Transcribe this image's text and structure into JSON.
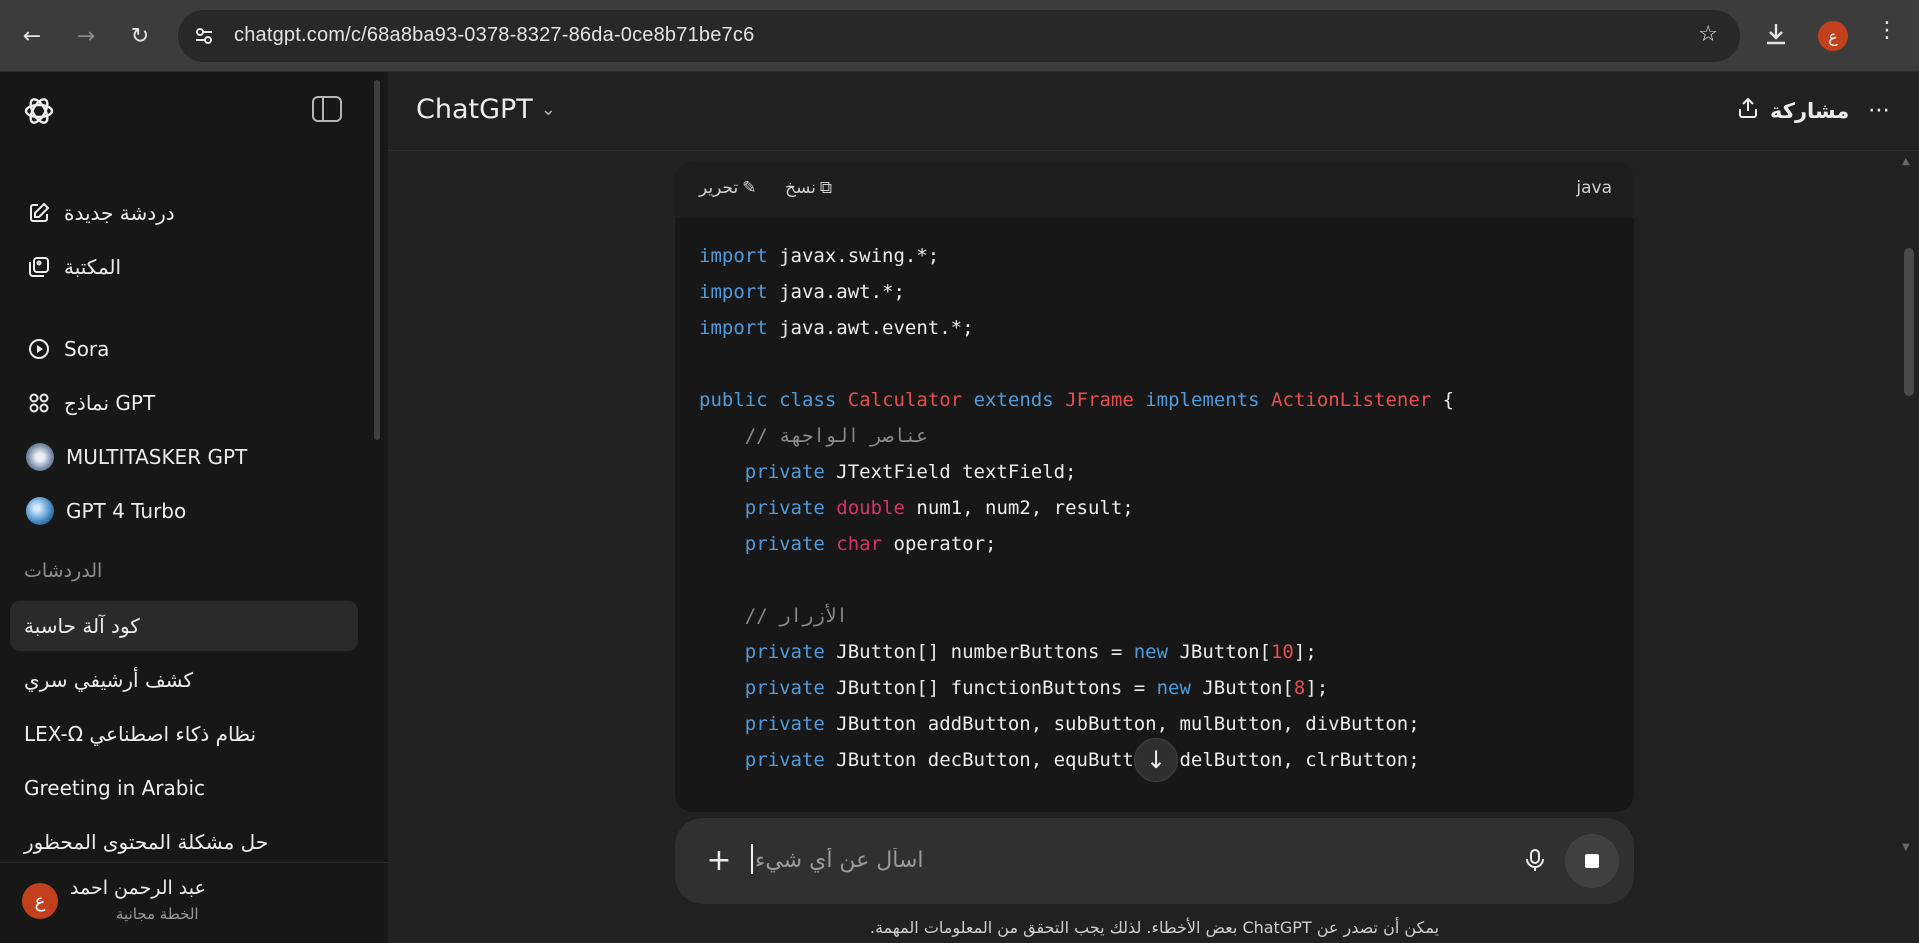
{
  "browser": {
    "url": "chatgpt.com/c/68a8ba93-0378-8327-86da-0ce8b71be7c6",
    "profile_initial": "ع"
  },
  "sidebar": {
    "top_items": [
      {
        "label": "دردشة جديدة",
        "icon": "new-chat-icon"
      },
      {
        "label": "المكتبة",
        "icon": "library-icon"
      }
    ],
    "gpt_items": [
      {
        "label": "Sora",
        "icon": "sora-icon"
      },
      {
        "label": "نماذج GPT",
        "icon": "gpts-grid-icon"
      },
      {
        "label": "MULTITASKER GPT",
        "icon": "custom-gpt-avatar"
      },
      {
        "label": "GPT 4 Turbo",
        "icon": "custom-gpt-avatar"
      }
    ],
    "section_label": "الدردشات",
    "chats": [
      "كود آلة حاسبة",
      "كشف أرشيفي سري",
      "LEX-Ω نظام ذكاء اصطناعي",
      "Greeting in Arabic",
      "حل مشكلة المحتوى المحظور"
    ],
    "user": {
      "initial": "ع",
      "name": "عبد الرحمن احمد",
      "plan": "الخطة مجانية"
    }
  },
  "header": {
    "model_label": "ChatGPT",
    "share_label": "مشاركة"
  },
  "code_block": {
    "language": "java",
    "copy_label": "نسخ",
    "edit_label": "تحرير",
    "lines": [
      "import javax.swing.*;",
      "import java.awt.*;",
      "import java.awt.event.*;",
      "",
      "public class Calculator extends JFrame implements ActionListener {",
      "    // عناصر الواجهة",
      "    private JTextField textField;",
      "    private double num1, num2, result;",
      "    private char operator;",
      "",
      "    // الأزرار",
      "    private JButton[] numberButtons = new JButton[10];",
      "    private JButton[] functionButtons = new JButton[8];",
      "    private JButton addButton, subButton, mulButton, divButton;",
      "    private JButton decButton, equButton, delButton, clrButton;"
    ]
  },
  "composer": {
    "placeholder": "اسأل عن أي شيء"
  },
  "disclaimer": "يمكن أن تصدر عن ChatGPT بعض الأخطاء. لذلك يجب التحقق من المعلومات المهمة."
}
